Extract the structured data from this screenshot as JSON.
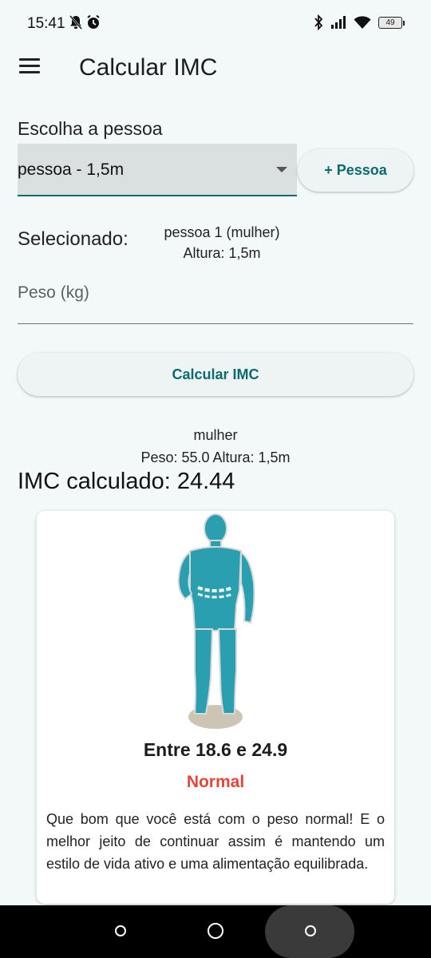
{
  "status_bar": {
    "time": "15:41",
    "left_icons": [
      "mute-bell-icon",
      "alarm-icon"
    ],
    "right_icons": [
      "bluetooth-icon",
      "signal-icon",
      "wifi-icon",
      "battery-icon"
    ],
    "battery": "49"
  },
  "app_bar": {
    "menu_icon": "hamburger-menu-icon",
    "title": "Calcular IMC"
  },
  "form": {
    "choose_label": "Escolha a pessoa",
    "dropdown_value": "pessoa - 1,5m",
    "add_person_label": "+ Pessoa",
    "selected_label": "Selecionado:",
    "selected_name": "pessoa 1  (mulher)",
    "selected_height": "Altura: 1,5m",
    "weight_placeholder": "Peso (kg)",
    "calc_button_label": "Calcular IMC"
  },
  "result": {
    "gender": "mulher",
    "details": "Peso: 55.0  Altura: 1,5m",
    "imc_text": "IMC calculado: 24.44"
  },
  "card": {
    "figure_icon": "human-body-figure-icon",
    "range": "Entre 18.6 e 24.9",
    "category": "Normal",
    "description": "Que bom que você está com o peso normal! E o melhor jeito de continuar assim é mantendo um estilo de vida ativo e uma alimentação equilibrada."
  },
  "nav_bar": {
    "buttons": [
      "nav-back-icon",
      "nav-home-icon",
      "nav-recents-icon"
    ]
  },
  "colors": {
    "accent": "#0b6a70",
    "background": "#f3f9f8",
    "figure": "#2a9fb0",
    "category": "#e0473a"
  }
}
